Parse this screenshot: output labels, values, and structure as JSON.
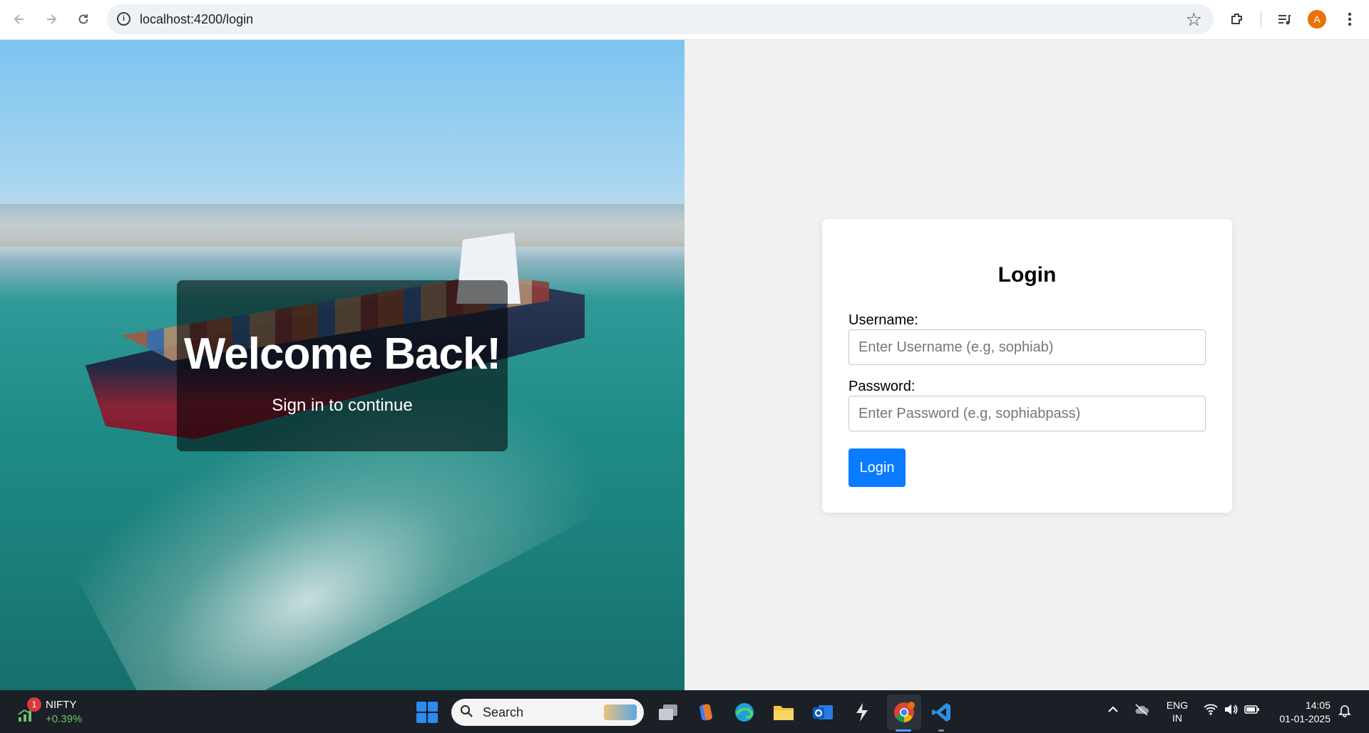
{
  "browser": {
    "url": "localhost:4200/login",
    "avatar_letter": "A"
  },
  "hero": {
    "title": "Welcome Back!",
    "subtitle": "Sign in to continue"
  },
  "login": {
    "title": "Login",
    "username_label": "Username:",
    "username_placeholder": "Enter Username (e.g, sophiab)",
    "password_label": "Password:",
    "password_placeholder": "Enter Password (e.g, sophiabpass)",
    "submit_label": "Login"
  },
  "taskbar": {
    "widget_badge": "1",
    "widget_name": "NIFTY",
    "widget_change": "+0.39%",
    "search_label": "Search",
    "lang_line1": "ENG",
    "lang_line2": "IN",
    "time": "14:05",
    "date": "01-01-2025"
  },
  "colors": {
    "primary_button": "#0a7bff",
    "avatar": "#e8710a",
    "taskbar": "#1b1f26"
  }
}
